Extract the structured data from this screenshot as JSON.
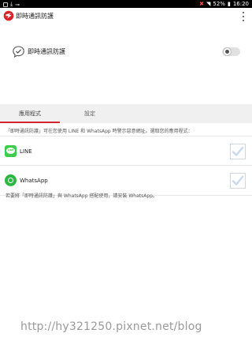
{
  "status_bar": {
    "battery": "52%",
    "time": "16:20",
    "icons": [
      "gallery-icon",
      "download-icon",
      "vpn-key-icon",
      "mute-icon",
      "wifi-icon",
      "battery-icon"
    ]
  },
  "app_bar": {
    "title": "即時通訊防護",
    "logo_icon": "trend-micro-logo-icon",
    "menu_icon": "more-vert-icon"
  },
  "toggle_row": {
    "label": "即時通訊防護",
    "icon": "chat-shield-icon",
    "enabled": false
  },
  "tabs": [
    {
      "label": "應用程式",
      "selected": true
    },
    {
      "label": "設定",
      "selected": false
    }
  ],
  "intro_text": "「即時通訊防護」可在您使用 LINE 和 WhatsApp 時警示惡意網址。選取您的應用程式：",
  "apps": [
    {
      "name": "LINE",
      "icon": "line-app-icon",
      "checked": true
    },
    {
      "name": "WhatsApp",
      "icon": "whatsapp-app-icon",
      "checked": true
    }
  ],
  "footnote": "若要將「即時通訊防護」與 WhatsApp 搭配使用，請安裝 WhatsApp。",
  "watermark": "http://hy321250.pixnet.net/blog",
  "colors": {
    "accent": "#d6262d",
    "line_green": "#3ecb4a",
    "whatsapp_green": "#2bb741",
    "check_blue": "#c9d9ec"
  }
}
